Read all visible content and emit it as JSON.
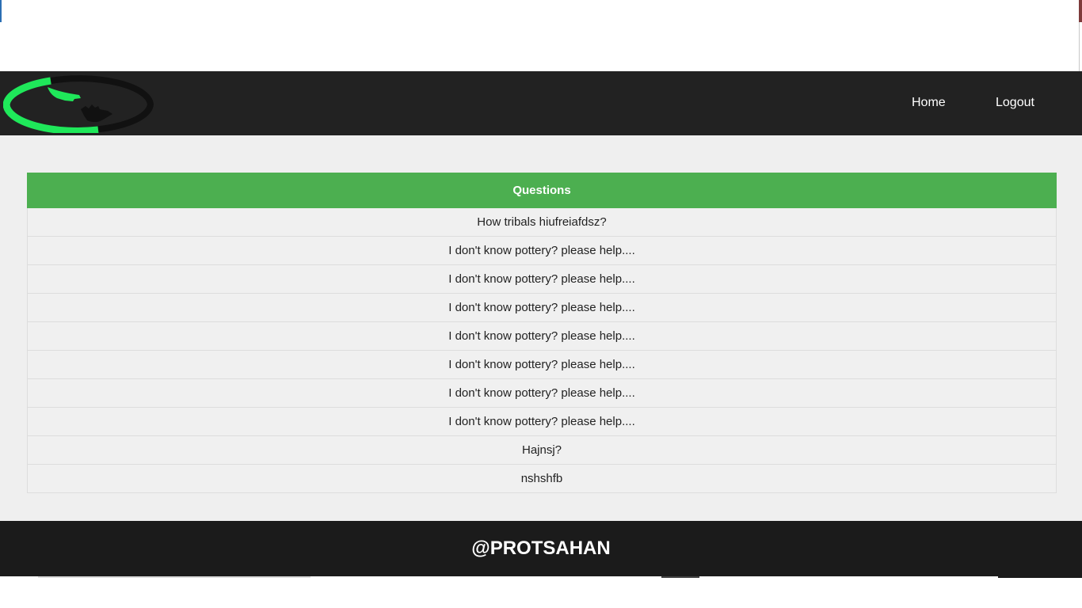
{
  "nav": {
    "home_label": "Home",
    "logout_label": "Logout",
    "logo_colors": {
      "green": "#1fe85a",
      "dark": "#111111"
    }
  },
  "questions": {
    "header": "Questions",
    "header_color": "#4caf50",
    "items": [
      "How tribals hiufreiafdsz?",
      "I don't know pottery? please help....",
      "I don't know pottery? please help....",
      "I don't know pottery? please help....",
      "I don't know pottery? please help....",
      "I don't know pottery? please help....",
      "I don't know pottery? please help....",
      "I don't know pottery? please help....",
      "Hajnsj?",
      "nshshfb"
    ]
  },
  "footer": {
    "text": "@PROTSAHAN"
  }
}
